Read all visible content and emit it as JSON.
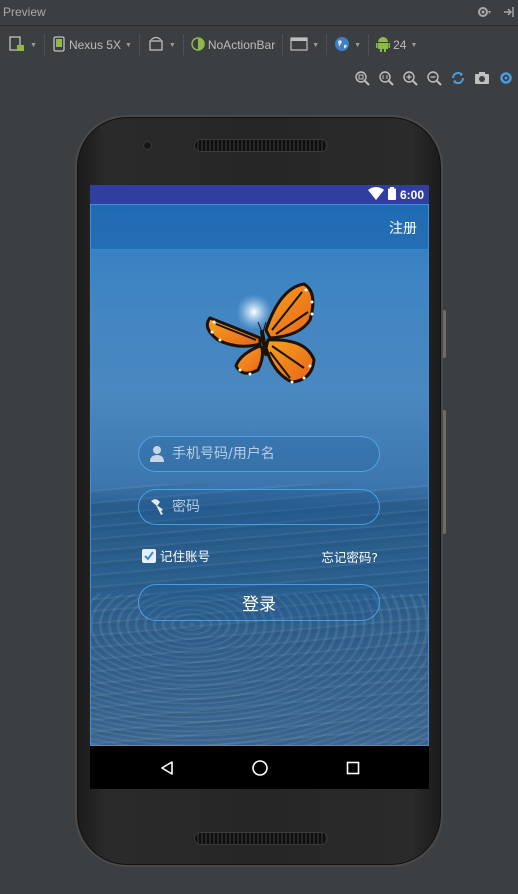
{
  "ide": {
    "panel_title": "Preview",
    "toolbar": {
      "device": "Nexus 5X",
      "theme": "NoActionBar",
      "api_level": "24"
    }
  },
  "device": {
    "status_time": "6:00"
  },
  "app": {
    "register_label": "注册",
    "username_placeholder": "手机号码/用户名",
    "password_placeholder": "密码",
    "remember_label": "记住账号",
    "remember_checked": true,
    "forgot_label": "忘记密码?",
    "login_label": "登录"
  },
  "colors": {
    "statusbar": "#303f9f",
    "appbar": "#1e6fb4",
    "field_border": "#50aaf0",
    "text": "#ffffff"
  },
  "icons": {
    "username_field": "user-icon",
    "password_field": "key-icon",
    "nav": [
      "back-icon",
      "home-icon",
      "recents-icon"
    ]
  }
}
